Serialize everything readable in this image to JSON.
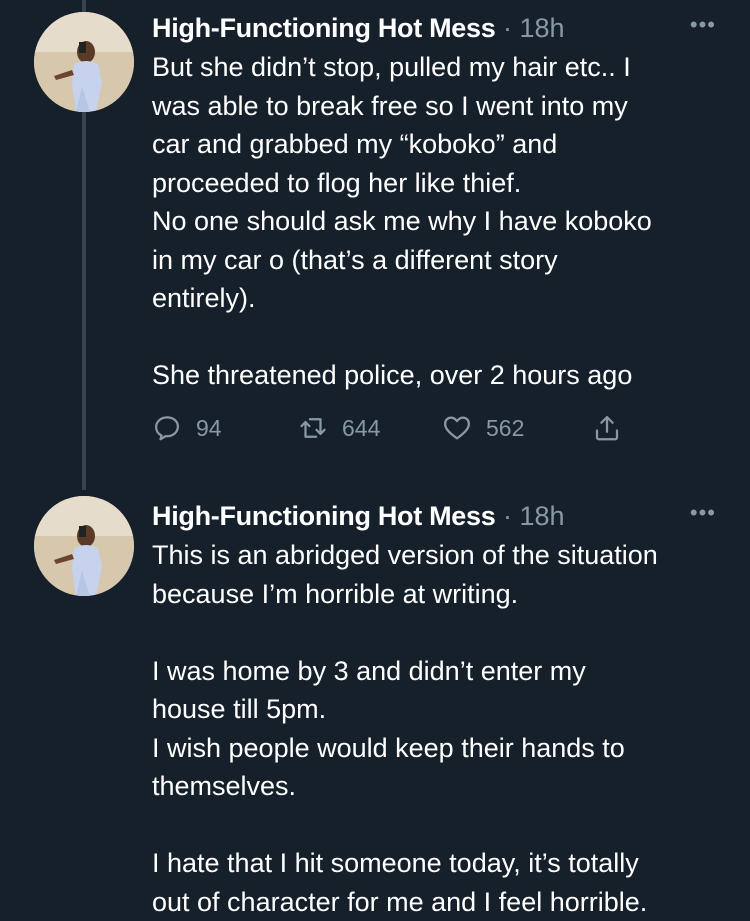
{
  "tweets": [
    {
      "author": "High-Functioning Hot Mess",
      "separator": "·",
      "time": "18h",
      "more_label": "•••",
      "lines": [
        "But she didn’t stop, pulled my hair etc.. I",
        "was able to break free so I went into my",
        "car and grabbed my “koboko” and",
        "proceeded to flog her like thief.",
        "No one should ask me why I have koboko",
        "in my car o (that’s a different story",
        "entirely).",
        "",
        "She threatened police, over 2 hours ago"
      ],
      "actions": {
        "reply_count": "94",
        "retweet_count": "644",
        "like_count": "562"
      }
    },
    {
      "author": "High-Functioning Hot Mess",
      "separator": "·",
      "time": "18h",
      "more_label": "•••",
      "lines": [
        "This is an abridged version of the situation",
        "because I’m horrible at writing.",
        "",
        "I was home by 3 and didn’t enter my",
        "house till 5pm.",
        "I wish people would keep their hands to",
        "themselves.",
        "",
        "I hate that I hit someone today, it’s totally",
        "out of character for me and I feel horrible."
      ]
    }
  ],
  "icons": {
    "reply": "reply-icon",
    "retweet": "retweet-icon",
    "like": "heart-icon",
    "share": "share-icon"
  },
  "colors": {
    "background": "#15202b",
    "text": "#ffffff",
    "secondary": "#8899a6",
    "thread_line": "#38444d"
  }
}
